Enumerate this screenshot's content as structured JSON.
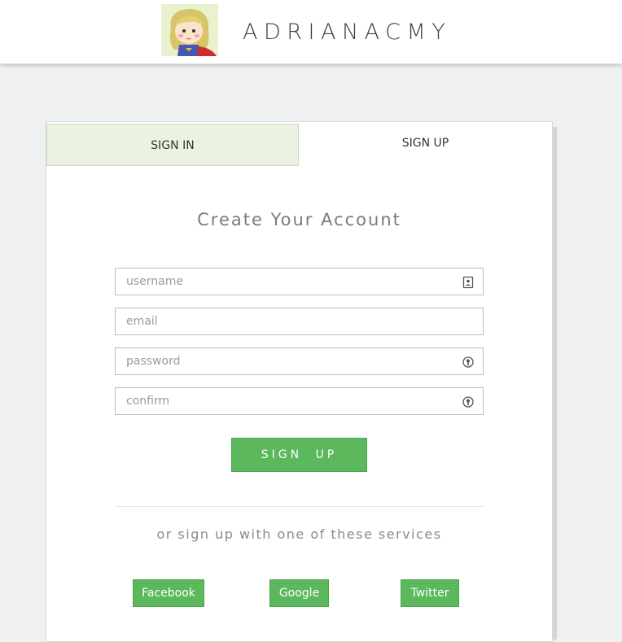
{
  "header": {
    "brand": "ADRIANACMY",
    "avatar_icon": "superhero-girl-avatar"
  },
  "tabs": [
    {
      "label": "SIGN IN",
      "active": false
    },
    {
      "label": "SIGN UP",
      "active": true
    }
  ],
  "form": {
    "title": "Create Your Account",
    "fields": [
      {
        "placeholder": "username",
        "value": "",
        "icon": "user-id-icon"
      },
      {
        "placeholder": "email",
        "value": "",
        "icon": ""
      },
      {
        "placeholder": "password",
        "value": "",
        "icon": "lock-icon"
      },
      {
        "placeholder": "confirm",
        "value": "",
        "icon": "lock-icon"
      }
    ],
    "submit_label": "SIGN UP"
  },
  "social": {
    "prompt": "or sign up with one of these services",
    "buttons": [
      "Facebook",
      "Google",
      "Twitter"
    ]
  },
  "colors": {
    "accent_green": "#5cb85c",
    "inactive_tab_bg": "#ebf3e0",
    "page_bg": "#eff0f2"
  }
}
